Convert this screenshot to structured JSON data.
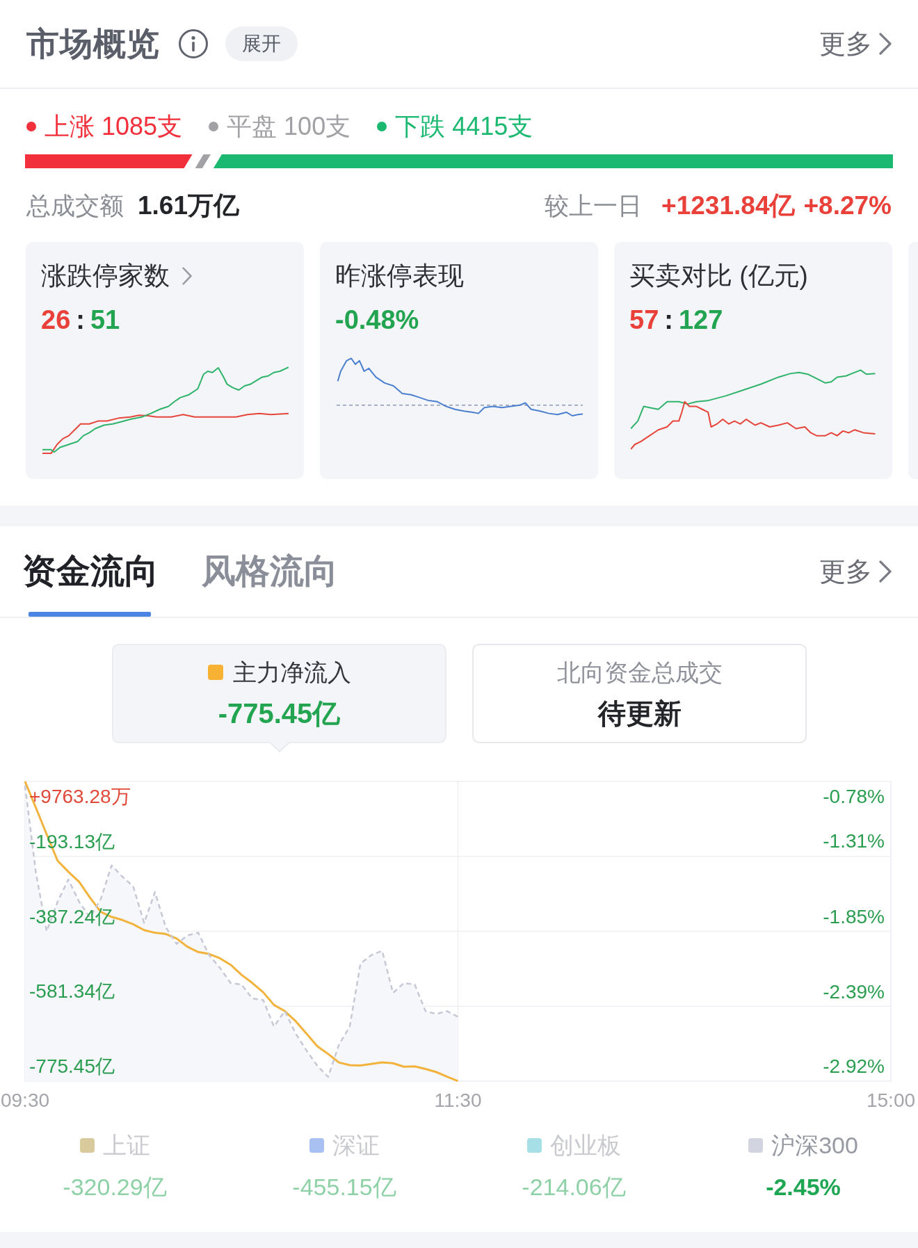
{
  "header": {
    "title": "市场概览",
    "expand_button": "展开",
    "more": "更多"
  },
  "breadth": [
    {
      "kind": "rise",
      "text": "上涨 1085支",
      "color": "#f2303c",
      "level": 0.194
    },
    {
      "kind": "flat",
      "text": "平盘 100支",
      "color": "#a2a2a6"
    },
    {
      "kind": "fall",
      "text": "下跌 4415支",
      "color": "#1bb872",
      "level": 0.788
    }
  ],
  "turnover": {
    "label": "总成交额",
    "value": "1.61万亿",
    "compare_label": "较上一日",
    "change_amount": "+1231.84亿",
    "change_percent": "+8.27%",
    "rising": true
  },
  "cards": [
    {
      "kind": "ratio",
      "title": "涨跌停家数",
      "link": true,
      "up": "26",
      "separator": ":",
      "down": "51"
    },
    {
      "kind": "change",
      "title": "昨涨停表现",
      "link": false,
      "value": "-0.48%",
      "rising": false
    },
    {
      "kind": "ratio",
      "title": "买卖对比 (亿元)",
      "link": false,
      "up": "57",
      "separator": ":",
      "down": "127"
    },
    {
      "kind": "clipped"
    }
  ],
  "flow": {
    "tabs": [
      {
        "label": "资金流向",
        "selected": true
      },
      {
        "label": "风格流向",
        "selected": false
      }
    ],
    "more": "更多",
    "summary": [
      {
        "label": "主力净流入",
        "value": "-775.45亿",
        "color": "#f7b234",
        "rising": false,
        "selected": true
      },
      {
        "label": "北向资金总成交",
        "value": "待更新",
        "selected": false
      }
    ],
    "chart_top_labels": {
      "left": {
        "text": "+9763.28万",
        "rising": true
      },
      "right": {
        "text": "-0.78%",
        "rising": false
      }
    },
    "chart_data": {
      "type": "line",
      "grid": true,
      "categories": [
        "09:30",
        null,
        null,
        null,
        null,
        null,
        null,
        null,
        null,
        null,
        null,
        null,
        null,
        null,
        null,
        null,
        null,
        null,
        null,
        null,
        null,
        null,
        null,
        null,
        null,
        null,
        null,
        null,
        null,
        null,
        null,
        null,
        null,
        null,
        null,
        null,
        null,
        null,
        null,
        null,
        "11:30",
        null,
        null,
        null,
        null,
        null,
        null,
        null,
        null,
        null,
        null,
        null,
        null,
        null,
        null,
        null,
        null,
        null,
        null,
        null,
        null,
        null,
        null,
        null,
        null,
        null,
        null,
        null,
        null,
        null,
        null,
        null,
        null,
        null,
        null,
        null,
        null,
        null,
        null,
        null,
        "15:00"
      ],
      "ylim": [
        -775.45,
        1
      ],
      "yticks": [
        {
          "value": -193.13,
          "label": "-193.13亿"
        },
        {
          "value": -387.24,
          "label": "-387.24亿"
        },
        {
          "value": -581.34,
          "label": "-581.34亿"
        },
        {
          "value": -775.45,
          "label": "-775.45亿"
        }
      ],
      "y2lim": [
        -2.92,
        -0.78
      ],
      "y2ticks": [
        {
          "value": -1.31,
          "label": "-1.31%"
        },
        {
          "value": -1.85,
          "label": "-1.85%"
        },
        {
          "value": -2.39,
          "label": "-2.39%"
        },
        {
          "value": -2.92,
          "label": "-2.92%"
        }
      ],
      "series": [
        {
          "color": "#f2b33d",
          "values": [
            1,
            -67,
            -136,
            -204,
            -233,
            -259,
            -300,
            -337,
            -350,
            -358,
            -369,
            -384,
            -391,
            -394,
            -406,
            -427,
            -441,
            -446,
            -457,
            -474,
            -500,
            -521,
            -545,
            -578,
            -594,
            -620,
            -652,
            -685,
            -705,
            -727,
            -734,
            -735,
            -731,
            -727,
            -729,
            -738,
            -737,
            -744,
            -752,
            -764,
            -775,
            null,
            null,
            null,
            null,
            null,
            null,
            null,
            null,
            null,
            null,
            null,
            null,
            null,
            null,
            null,
            null,
            null,
            null,
            null,
            null,
            null,
            null,
            null,
            null,
            null,
            null,
            null,
            null,
            null,
            null,
            null,
            null,
            null,
            null,
            null,
            null,
            null,
            null,
            null,
            null
          ]
        },
        {
          "color": "#c6c9d5",
          "axis": "y2",
          "line_style": "dashed",
          "values": [
            -0.81,
            -1.43,
            -1.85,
            -1.64,
            -1.48,
            -1.64,
            -1.75,
            -1.62,
            -1.38,
            -1.46,
            -1.53,
            -1.79,
            -1.57,
            -1.82,
            -1.94,
            -1.88,
            -1.86,
            -2.02,
            -2.11,
            -2.22,
            -2.23,
            -2.33,
            -2.34,
            -2.53,
            -2.42,
            -2.58,
            -2.7,
            -2.81,
            -2.89,
            -2.66,
            -2.53,
            -2.08,
            -2.02,
            -1.99,
            -2.29,
            -2.22,
            -2.23,
            -2.42,
            -2.44,
            -2.42,
            -2.46,
            null,
            null,
            null,
            null,
            null,
            null,
            null,
            null,
            null,
            null,
            null,
            null,
            null,
            null,
            null,
            null,
            null,
            null,
            null,
            null,
            null,
            null,
            null,
            null,
            null,
            null,
            null,
            null,
            null,
            null,
            null,
            null,
            null,
            null,
            null,
            null,
            null,
            null,
            null,
            null
          ]
        }
      ]
    },
    "legend": [
      {
        "label": "上证",
        "color": "#d8ca9c",
        "value": "-320.29亿",
        "selected": false
      },
      {
        "label": "深证",
        "color": "#a9c0f2",
        "value": "-455.15亿",
        "selected": false
      },
      {
        "label": "创业板",
        "color": "#a6e0e6",
        "value": "-214.06亿",
        "selected": false
      },
      {
        "label": "沪深300",
        "color": "#d2d4e0",
        "value": "-2.45%",
        "selected": true
      }
    ]
  }
}
